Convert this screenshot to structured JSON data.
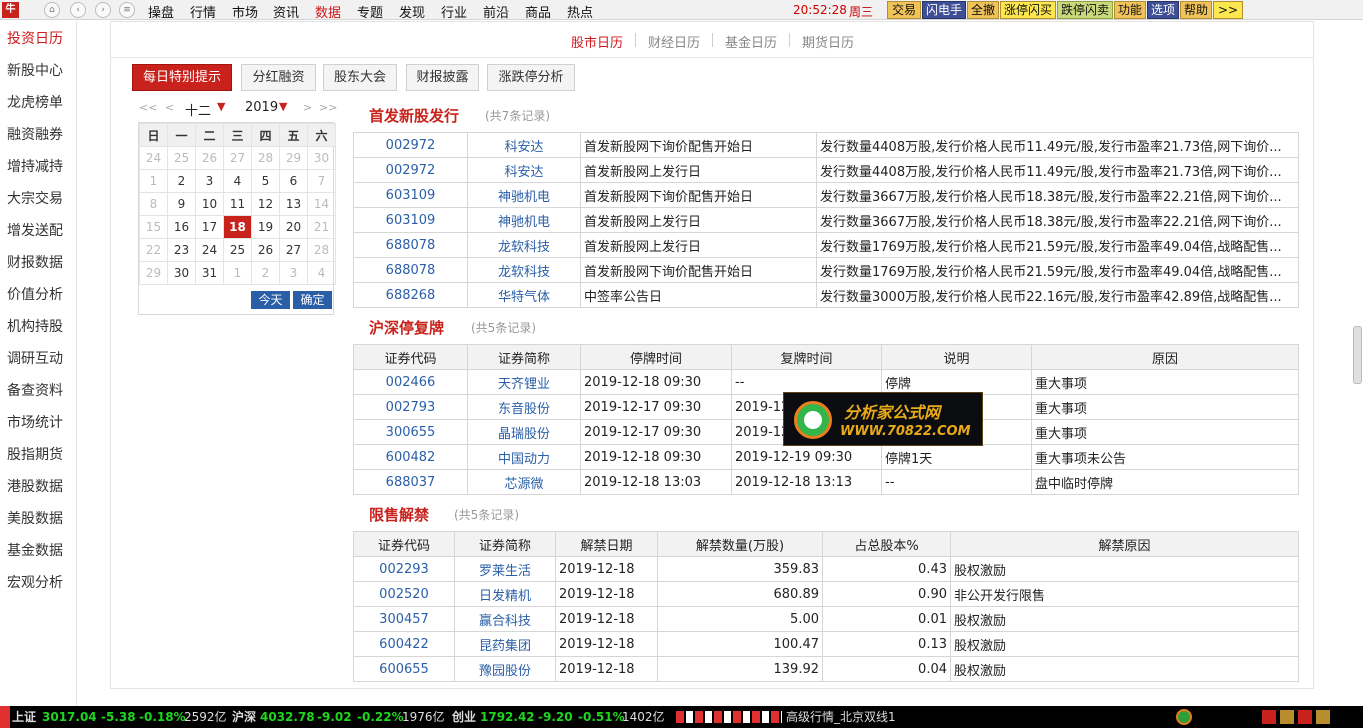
{
  "topbar": {
    "app_icon": "app-logo",
    "nav_icons": [
      "home-icon",
      "back-icon",
      "forward-icon",
      "menu-icon"
    ],
    "menu": [
      "操盘",
      "行情",
      "市场",
      "资讯",
      "数据",
      "专题",
      "发现",
      "行业",
      "前沿",
      "商品",
      "热点"
    ],
    "active_menu": "数据",
    "time": "20:52:28",
    "weekday": "周三",
    "buttons": [
      "交易",
      "闪电手",
      "全撤",
      "涨停闪买",
      "跌停闪卖",
      "功能",
      "选项",
      "帮助",
      ">>"
    ]
  },
  "sidebar": {
    "items": [
      "投资日历",
      "新股中心",
      "龙虎榜单",
      "融资融券",
      "增持减持",
      "大宗交易",
      "增发送配",
      "财报数据",
      "价值分析",
      "机构持股",
      "调研互动",
      "备查资料",
      "市场统计",
      "股指期货",
      "港股数据",
      "美股数据",
      "基金数据",
      "宏观分析"
    ],
    "active": "投资日历"
  },
  "subtabs": [
    "股市日历",
    "财经日历",
    "基金日历",
    "期货日历"
  ],
  "active_subtab": "股市日历",
  "quick_buttons": [
    "每日特别提示",
    "分红融资",
    "股东大会",
    "财报披露",
    "涨跌停分析"
  ],
  "calendar": {
    "prev_year": "<<",
    "prev_month": "<",
    "month": "十二",
    "year": "2019",
    "next_month": ">",
    "next_year": ">>",
    "weekdays": [
      "日",
      "一",
      "二",
      "三",
      "四",
      "五",
      "六"
    ],
    "weeks": [
      [
        "24",
        "25",
        "26",
        "27",
        "28",
        "29",
        "30"
      ],
      [
        "1",
        "2",
        "3",
        "4",
        "5",
        "6",
        "7"
      ],
      [
        "8",
        "9",
        "10",
        "11",
        "12",
        "13",
        "14"
      ],
      [
        "15",
        "16",
        "17",
        "18",
        "19",
        "20",
        "21"
      ],
      [
        "22",
        "23",
        "24",
        "25",
        "26",
        "27",
        "28"
      ],
      [
        "29",
        "30",
        "31",
        "1",
        "2",
        "3",
        "4"
      ]
    ],
    "selected_day": "18",
    "today_label": "今天",
    "confirm_label": "确定"
  },
  "ipo": {
    "title": "首发新股发行",
    "count": "(共7条记录)",
    "rows": [
      [
        "002972",
        "科安达",
        "首发新股网下询价配售开始日",
        "发行数量4408万股,发行价格人民币11.49元/股,发行市盈率21.73倍,网下询价..."
      ],
      [
        "002972",
        "科安达",
        "首发新股网上发行日",
        "发行数量4408万股,发行价格人民币11.49元/股,发行市盈率21.73倍,网下询价..."
      ],
      [
        "603109",
        "神驰机电",
        "首发新股网下询价配售开始日",
        "发行数量3667万股,发行价格人民币18.38元/股,发行市盈率22.21倍,网下询价..."
      ],
      [
        "603109",
        "神驰机电",
        "首发新股网上发行日",
        "发行数量3667万股,发行价格人民币18.38元/股,发行市盈率22.21倍,网下询价..."
      ],
      [
        "688078",
        "龙软科技",
        "首发新股网上发行日",
        "发行数量1769万股,发行价格人民币21.59元/股,发行市盈率49.04倍,战略配售..."
      ],
      [
        "688078",
        "龙软科技",
        "首发新股网下询价配售开始日",
        "发行数量1769万股,发行价格人民币21.59元/股,发行市盈率49.04倍,战略配售..."
      ],
      [
        "688268",
        "华特气体",
        "中签率公告日",
        "发行数量3000万股,发行价格人民币22.16元/股,发行市盈率42.89倍,战略配售..."
      ]
    ]
  },
  "suspension": {
    "title": "沪深停复牌",
    "count": "(共5条记录)",
    "headers": [
      "证券代码",
      "证券简称",
      "停牌时间",
      "复牌时间",
      "说明",
      "原因"
    ],
    "rows": [
      [
        "002466",
        "天齐锂业",
        "2019-12-18 09:30",
        "--",
        "停牌",
        "重大事项"
      ],
      [
        "002793",
        "东音股份",
        "2019-12-17 09:30",
        "2019-12-18 09:30",
        "",
        "重大事项"
      ],
      [
        "300655",
        "晶瑞股份",
        "2019-12-17 09:30",
        "2019-12-18 09:30",
        "",
        "重大事项"
      ],
      [
        "600482",
        "中国动力",
        "2019-12-18 09:30",
        "2019-12-19 09:30",
        "停牌1天",
        "重大事项未公告"
      ],
      [
        "688037",
        "芯源微",
        "2019-12-18 13:03",
        "2019-12-18 13:13",
        "--",
        "盘中临时停牌"
      ]
    ]
  },
  "unlock": {
    "title": "限售解禁",
    "count": "(共5条记录)",
    "headers": [
      "证券代码",
      "证券简称",
      "解禁日期",
      "解禁数量(万股)",
      "占总股本%",
      "解禁原因"
    ],
    "rows": [
      [
        "002293",
        "罗莱生活",
        "2019-12-18",
        "359.83",
        "0.43",
        "股权激励"
      ],
      [
        "002520",
        "日发精机",
        "2019-12-18",
        "680.89",
        "0.90",
        "非公开发行限售"
      ],
      [
        "300457",
        "赢合科技",
        "2019-12-18",
        "5.00",
        "0.01",
        "股权激励"
      ],
      [
        "600422",
        "昆药集团",
        "2019-12-18",
        "100.47",
        "0.13",
        "股权激励"
      ],
      [
        "600655",
        "豫园股份",
        "2019-12-18",
        "139.92",
        "0.04",
        "股权激励"
      ]
    ]
  },
  "watermark": {
    "line1": "分析家公式网",
    "line2": "WWW.70822.COM"
  },
  "statusbar": {
    "sh_label": "上证",
    "sh_index": "3017.04",
    "sh_change": "-5.38",
    "sh_pct": "-0.18%",
    "sh_amount": "2592亿",
    "hs_label": "沪深",
    "hs_index": "4032.78",
    "hs_change": "-9.02",
    "hs_pct": "-0.22%",
    "hs_amount": "1976亿",
    "cy_label": "创业",
    "cy_index": "1792.42",
    "cy_change": "-9.20",
    "cy_pct": "-0.51%",
    "cy_amount": "1402亿",
    "connection": "高级行情_北京双线1"
  }
}
